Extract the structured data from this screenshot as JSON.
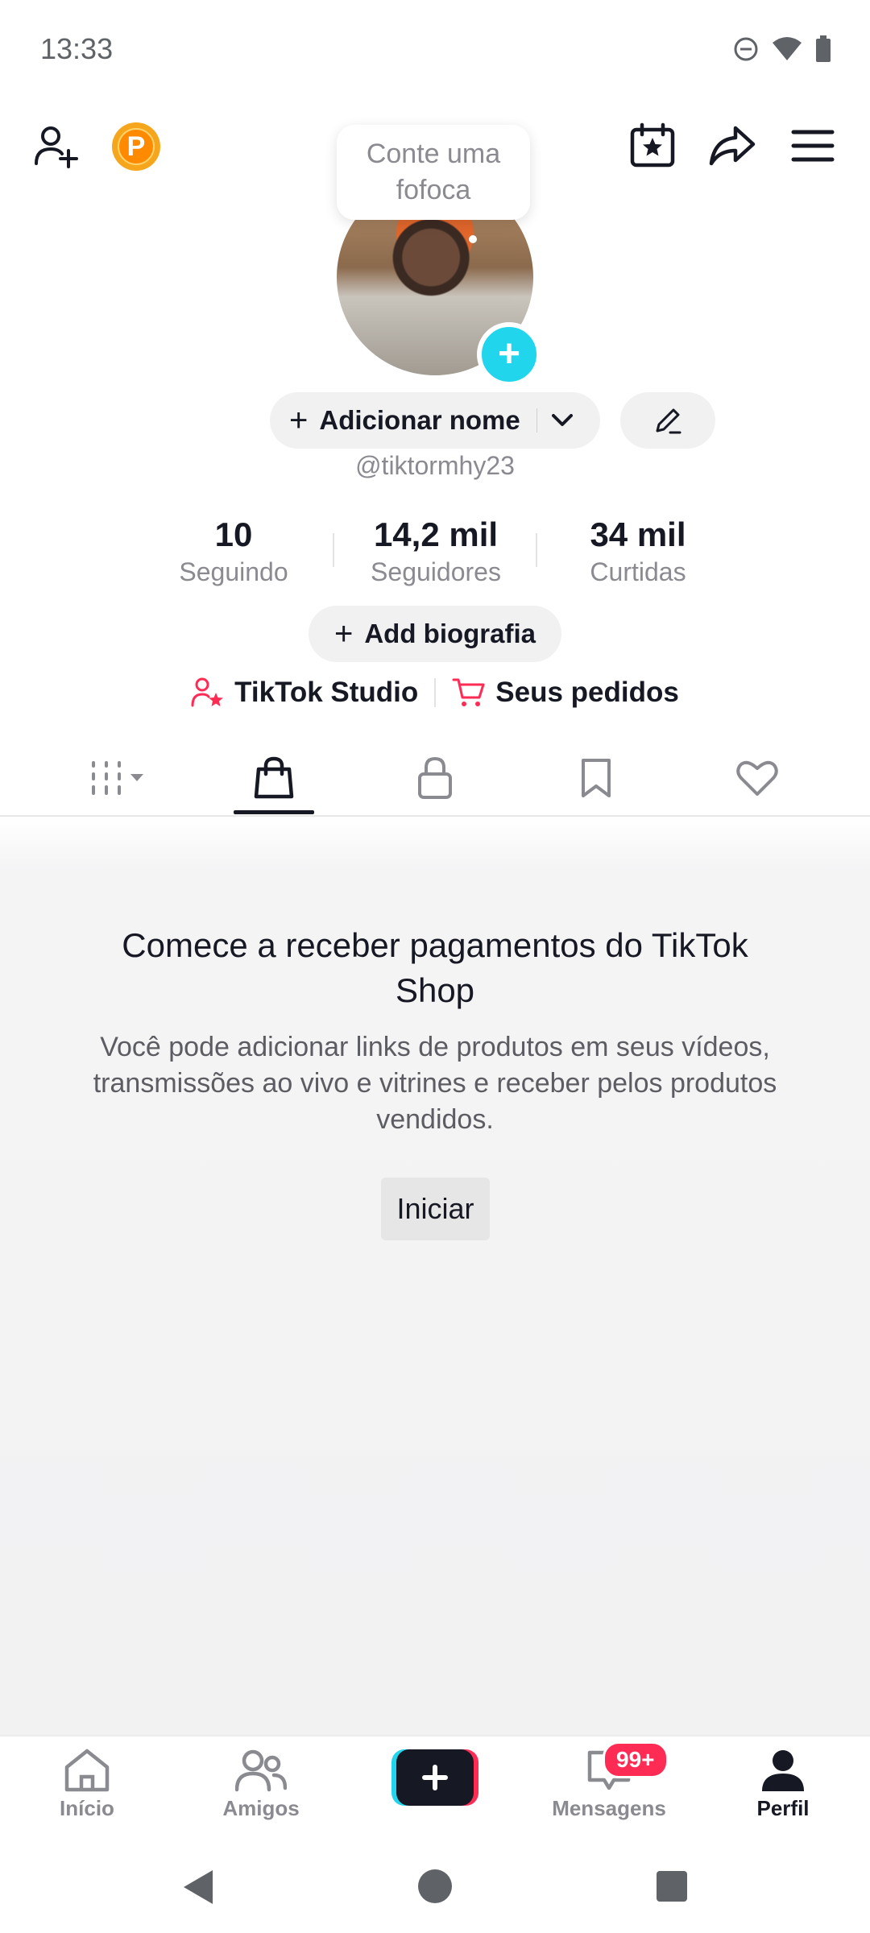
{
  "status_bar": {
    "time": "13:33"
  },
  "profile": {
    "bubble_line1": "Conte uma",
    "bubble_line2": "fofoca",
    "add_name_label": "Adicionar nome",
    "handle": "@tiktormhy23",
    "stats": [
      {
        "value": "10",
        "label": "Seguindo"
      },
      {
        "value": "14,2 mil",
        "label": "Seguidores"
      },
      {
        "value": "34 mil",
        "label": "Curtidas"
      }
    ],
    "bio_label": "Add biografia",
    "links": {
      "studio": "TikTok Studio",
      "orders": "Seus pedidos"
    },
    "coin_letter": "P"
  },
  "tabs": [
    {
      "icon": "grid-dropdown-icon"
    },
    {
      "icon": "shopping-bag-icon",
      "active": true
    },
    {
      "icon": "lock-icon"
    },
    {
      "icon": "bookmark-icon"
    },
    {
      "icon": "heart-icon"
    }
  ],
  "empty_state": {
    "title_line1": "Comece a receber pagamentos do TikTok",
    "title_line2": "Shop",
    "desc_line1": "Você pode adicionar links de produtos em seus vídeos,",
    "desc_line2": "transmissões ao vivo e vitrines e receber pelos produtos",
    "desc_line3": "vendidos.",
    "button": "Iniciar"
  },
  "bottom_nav": {
    "home": "Início",
    "friends": "Amigos",
    "inbox": "Mensagens",
    "inbox_badge": "99+",
    "profile": "Perfil"
  },
  "colors": {
    "accent_cyan": "#20d5ec",
    "accent_red": "#fe2c55",
    "text_primary": "#161823",
    "text_secondary": "#8a8b91"
  }
}
